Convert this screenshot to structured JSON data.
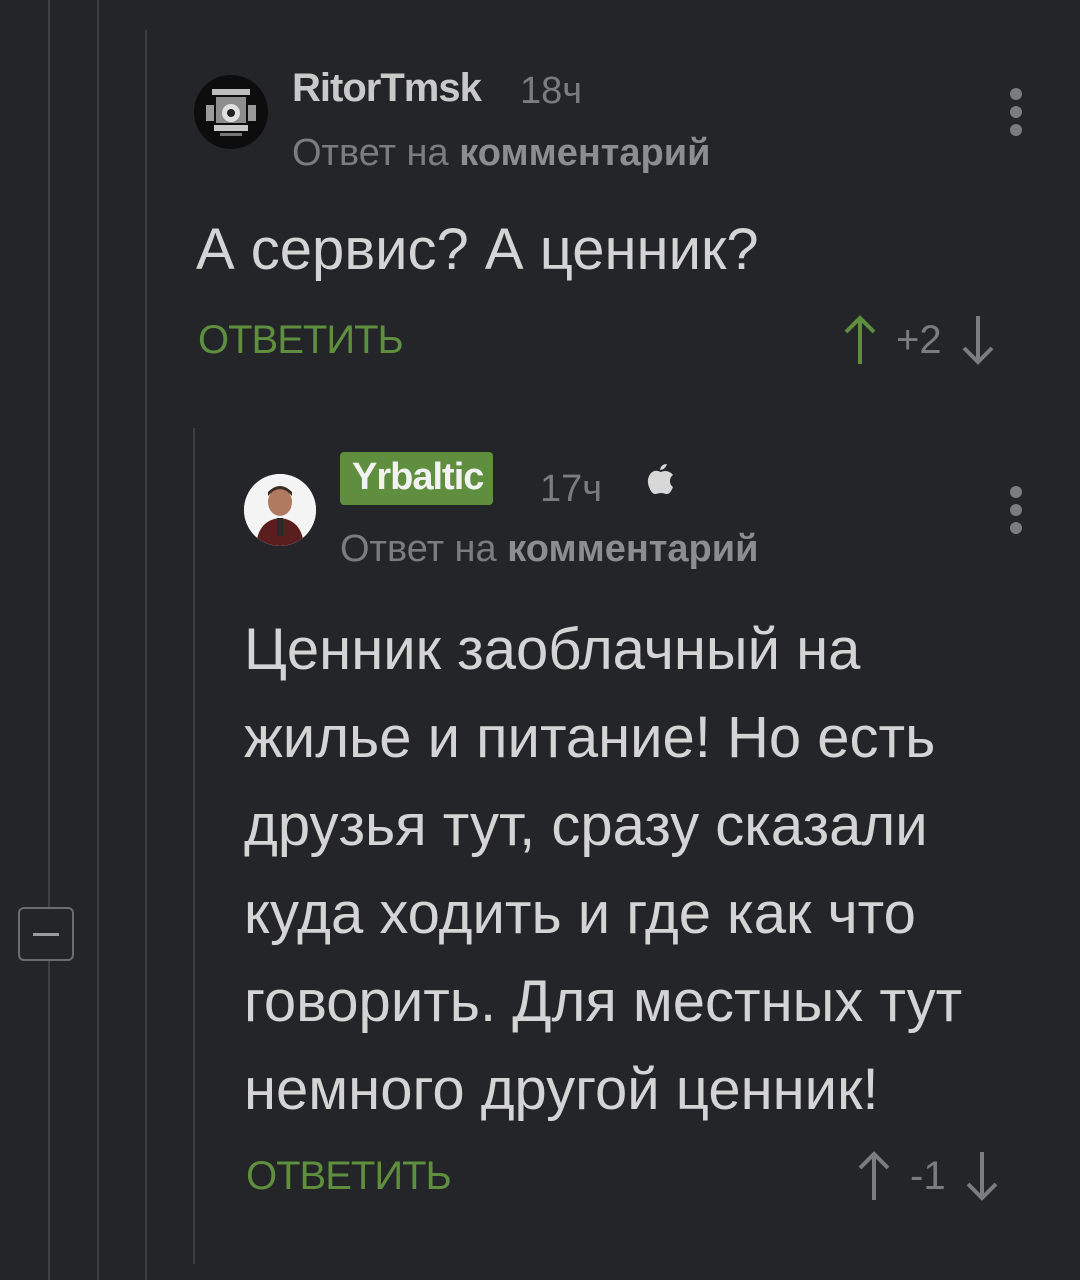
{
  "comments": [
    {
      "username": "RitorTmsk",
      "time": "18ч",
      "reply_prefix": "Ответ на",
      "reply_target": "комментарий",
      "text": "А сервис? А ценник?",
      "reply_label": "ОТВЕТИТЬ",
      "score": "+2"
    },
    {
      "username": "Yrbaltic",
      "time": "17ч",
      "reply_prefix": "Ответ на",
      "reply_target": "комментарий",
      "text": "Ценник заоблачный на жилье и питание! Но есть друзья тут, сразу сказали куда ходить и где как что говорить. Для местных тут немного другой ценник!",
      "reply_label": "ОТВЕТИТЬ",
      "score": "-1"
    }
  ],
  "colors": {
    "background": "#232528",
    "accent_green": "#5e8e3e",
    "muted_text": "#7a7c80",
    "thread_line": "#3d3f43"
  },
  "icons": {
    "upvote": "arrow-up-icon",
    "downvote": "arrow-down-icon",
    "more": "more-vertical-icon",
    "platform": "apple-icon",
    "collapse": "minus-icon"
  }
}
